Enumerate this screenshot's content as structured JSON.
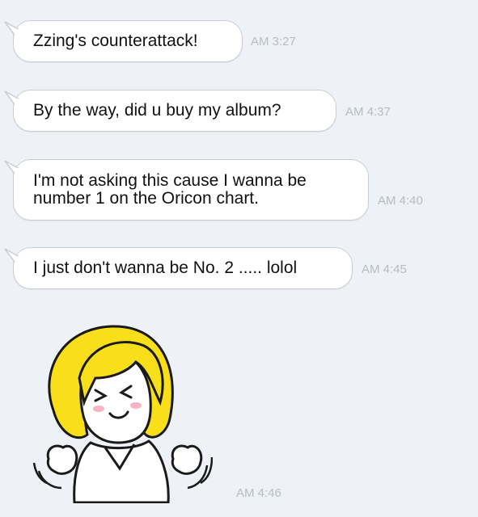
{
  "messages": [
    {
      "text": "Zzing's counterattack!",
      "time": "AM 3:27"
    },
    {
      "text": "By the way, did u buy my album?",
      "time": "AM 4:37"
    },
    {
      "text": "I'm not asking this cause I wanna be number 1 on the Oricon chart.",
      "time": "AM 4:40"
    },
    {
      "text": "I just don't wanna be No. 2 ..... lolol",
      "time": "AM 4:45"
    }
  ],
  "sticker": {
    "icon": "blonde-girl-sticker-icon",
    "time": "AM 4:46"
  },
  "colors": {
    "background": "#eef1f5",
    "bubble": "#ffffff",
    "bubble_border": "#c9ced6",
    "timestamp": "#b6bcc6"
  }
}
